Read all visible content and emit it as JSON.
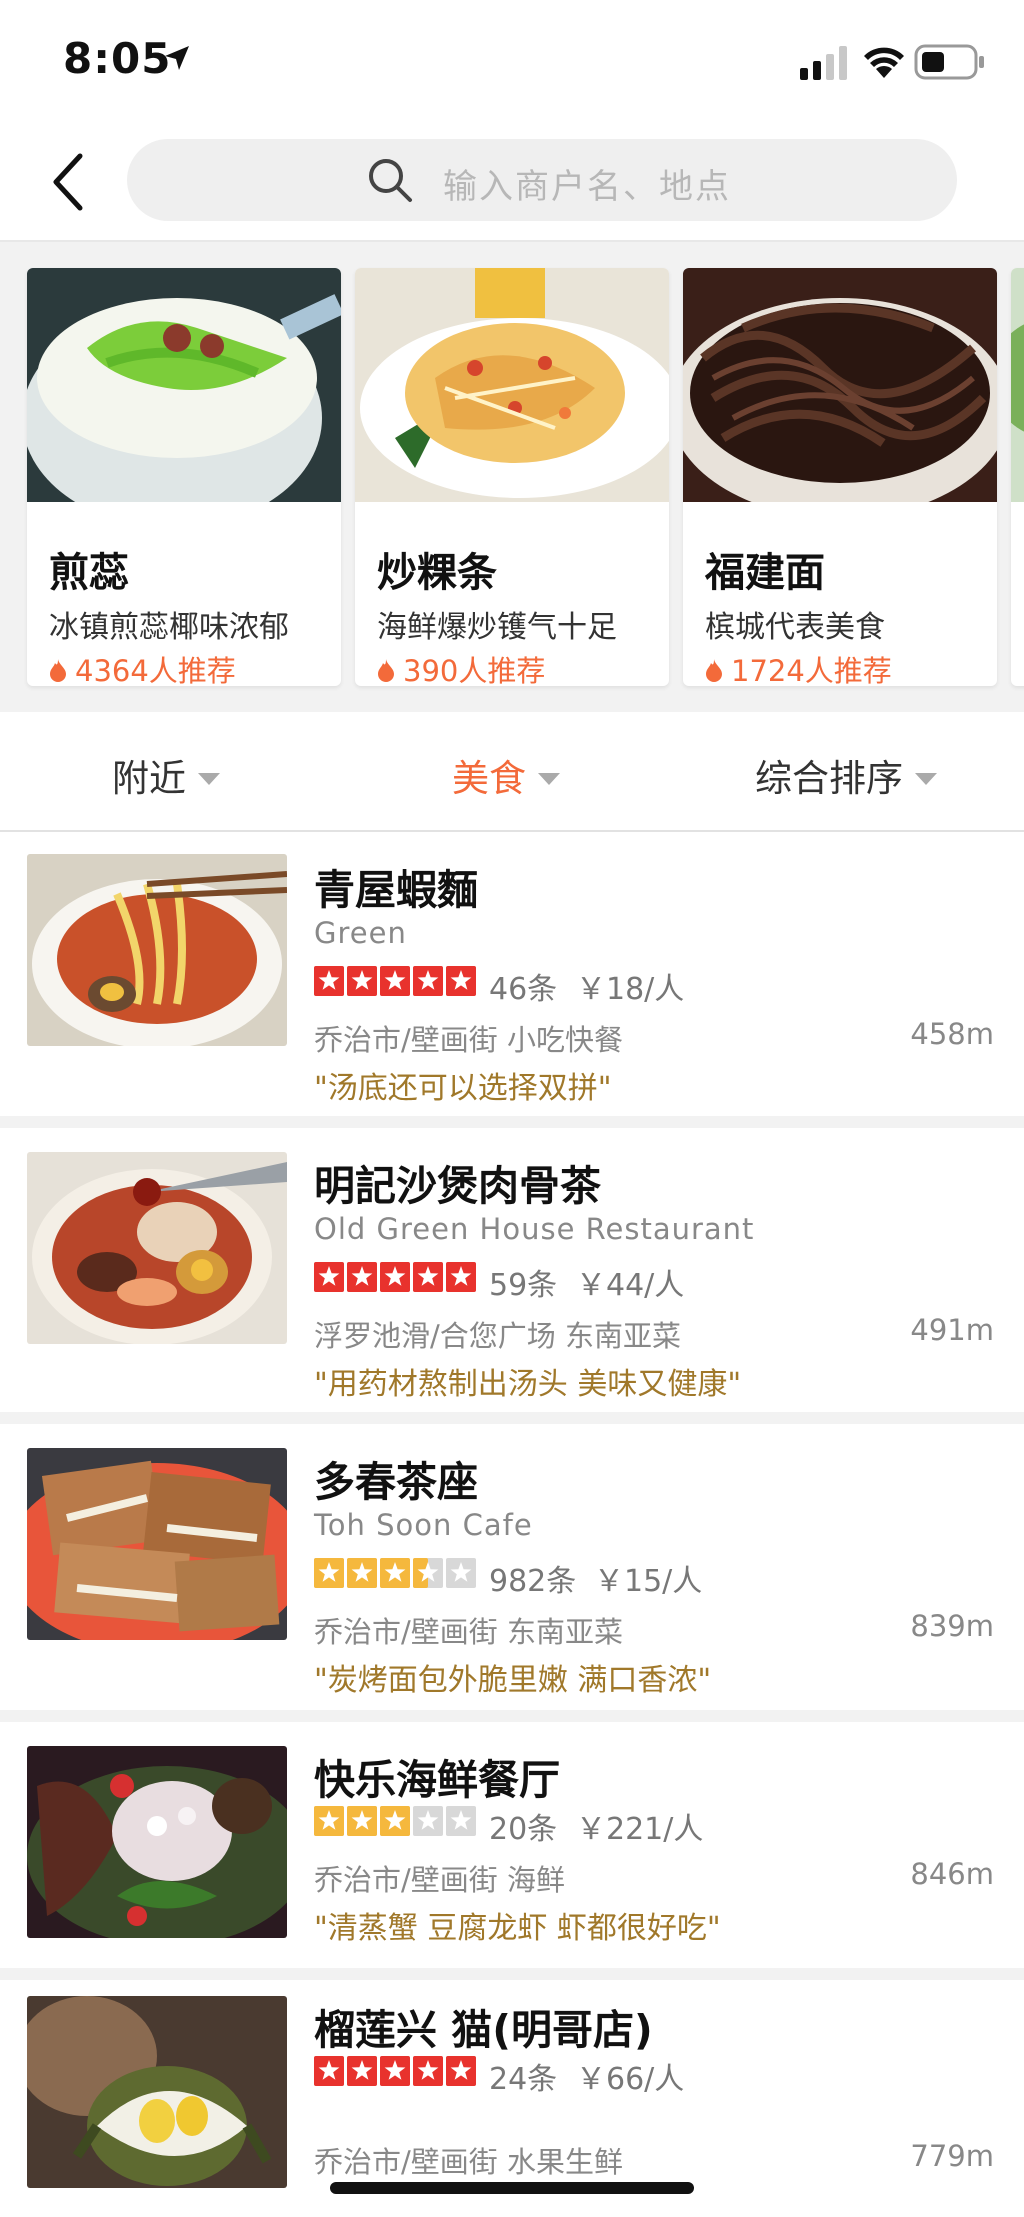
{
  "status_bar": {
    "time": "8:05"
  },
  "search": {
    "placeholder": "输入商户名、地点"
  },
  "featured": [
    {
      "title": "煎蕊",
      "subtitle": "冰镇煎蕊椰味浓郁",
      "recommend": "4364人推荐"
    },
    {
      "title": "炒粿条",
      "subtitle": "海鲜爆炒镬气十足",
      "recommend": "390人推荐"
    },
    {
      "title": "福建面",
      "subtitle": "槟城代表美食",
      "recommend": "1724人推荐"
    }
  ],
  "filters": [
    {
      "label": "附近",
      "active": false
    },
    {
      "label": "美食",
      "active": true
    },
    {
      "label": "综合排序",
      "active": false
    }
  ],
  "restaurants": [
    {
      "name": "青屋蝦麵",
      "english": "Green",
      "rating": 5,
      "reviews": "46条",
      "price": "￥18/人",
      "location": "乔治市/壁画街 小吃快餐",
      "distance": "458m",
      "quote": "\"汤底还可以选择双拼\""
    },
    {
      "name": "明記沙煲肉骨茶",
      "english": "Old Green House Restaurant",
      "rating": 5,
      "reviews": "59条",
      "price": "￥44/人",
      "location": "浮罗池滑/合您广场 东南亚菜",
      "distance": "491m",
      "quote": "\"用药材熬制出汤头 美味又健康\""
    },
    {
      "name": "多春茶座",
      "english": "Toh Soon Cafe",
      "rating": 3.5,
      "reviews": "982条",
      "price": "￥15/人",
      "location": "乔治市/壁画街 东南亚菜",
      "distance": "839m",
      "quote": "\"炭烤面包外脆里嫩 满口香浓\""
    },
    {
      "name": "快乐海鲜餐厅",
      "english": "",
      "rating": 3,
      "reviews": "20条",
      "price": "￥221/人",
      "location": "乔治市/壁画街 海鲜",
      "distance": "846m",
      "quote": "\"清蒸蟹 豆腐龙虾 虾都很好吃\""
    },
    {
      "name": "榴莲兴 猫(明哥店)",
      "english": "",
      "rating": 5,
      "reviews": "24条",
      "price": "￥66/人",
      "location": "乔治市/壁画街 水果生鲜",
      "distance": "779m",
      "quote": ""
    }
  ],
  "colors": {
    "accent": "#f36a3a",
    "star_red": "#e8322d",
    "star_yellow": "#f5b83d",
    "star_empty": "#d8d8d8",
    "quote": "#a0782a"
  },
  "icons": [
    "location-arrow-icon",
    "signal-icon",
    "wifi-icon",
    "battery-icon",
    "back-icon",
    "search-icon",
    "flame-icon",
    "star-icon",
    "caret-down-icon"
  ]
}
